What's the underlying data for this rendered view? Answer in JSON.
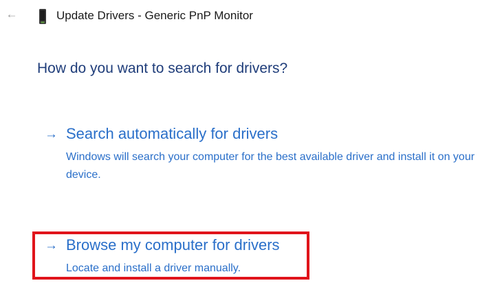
{
  "window": {
    "title": "Update Drivers - Generic PnP Monitor",
    "back_icon": "arrow-left-icon",
    "title_icon": "monitor-device-icon"
  },
  "heading": "How do you want to search for drivers?",
  "options": [
    {
      "arrow": "→",
      "title": "Search automatically for drivers",
      "description": "Windows will search your computer for the best available driver and install it on your device."
    },
    {
      "arrow": "→",
      "title": "Browse my computer for drivers",
      "description": "Locate and install a driver manually."
    }
  ],
  "colors": {
    "heading": "#1f3d7a",
    "link": "#2a6fc9",
    "highlight": "#e0141b"
  }
}
